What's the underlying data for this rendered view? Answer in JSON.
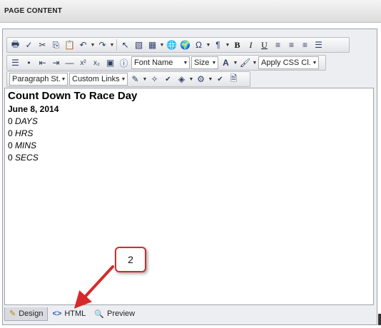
{
  "header": {
    "title": "PAGE CONTENT"
  },
  "toolbar": {
    "font_name": "Font Name",
    "size": "Size",
    "css_class": "Apply CSS Cl...",
    "paragraph_style": "Paragraph St...",
    "custom_links": "Custom Links"
  },
  "content": {
    "title": "Count Down To Race Day",
    "date": "June 8, 2014",
    "lines": [
      {
        "value": "0",
        "unit": "DAYS"
      },
      {
        "value": "0",
        "unit": "HRS"
      },
      {
        "value": "0",
        "unit": "MINS"
      },
      {
        "value": "0",
        "unit": "SECS"
      }
    ]
  },
  "tabs": {
    "design": "Design",
    "html": "HTML",
    "preview": "Preview"
  },
  "callout": {
    "number": "2"
  },
  "colors": {
    "callout_border": "#d62a2a",
    "accent": "#2c5fb0"
  }
}
